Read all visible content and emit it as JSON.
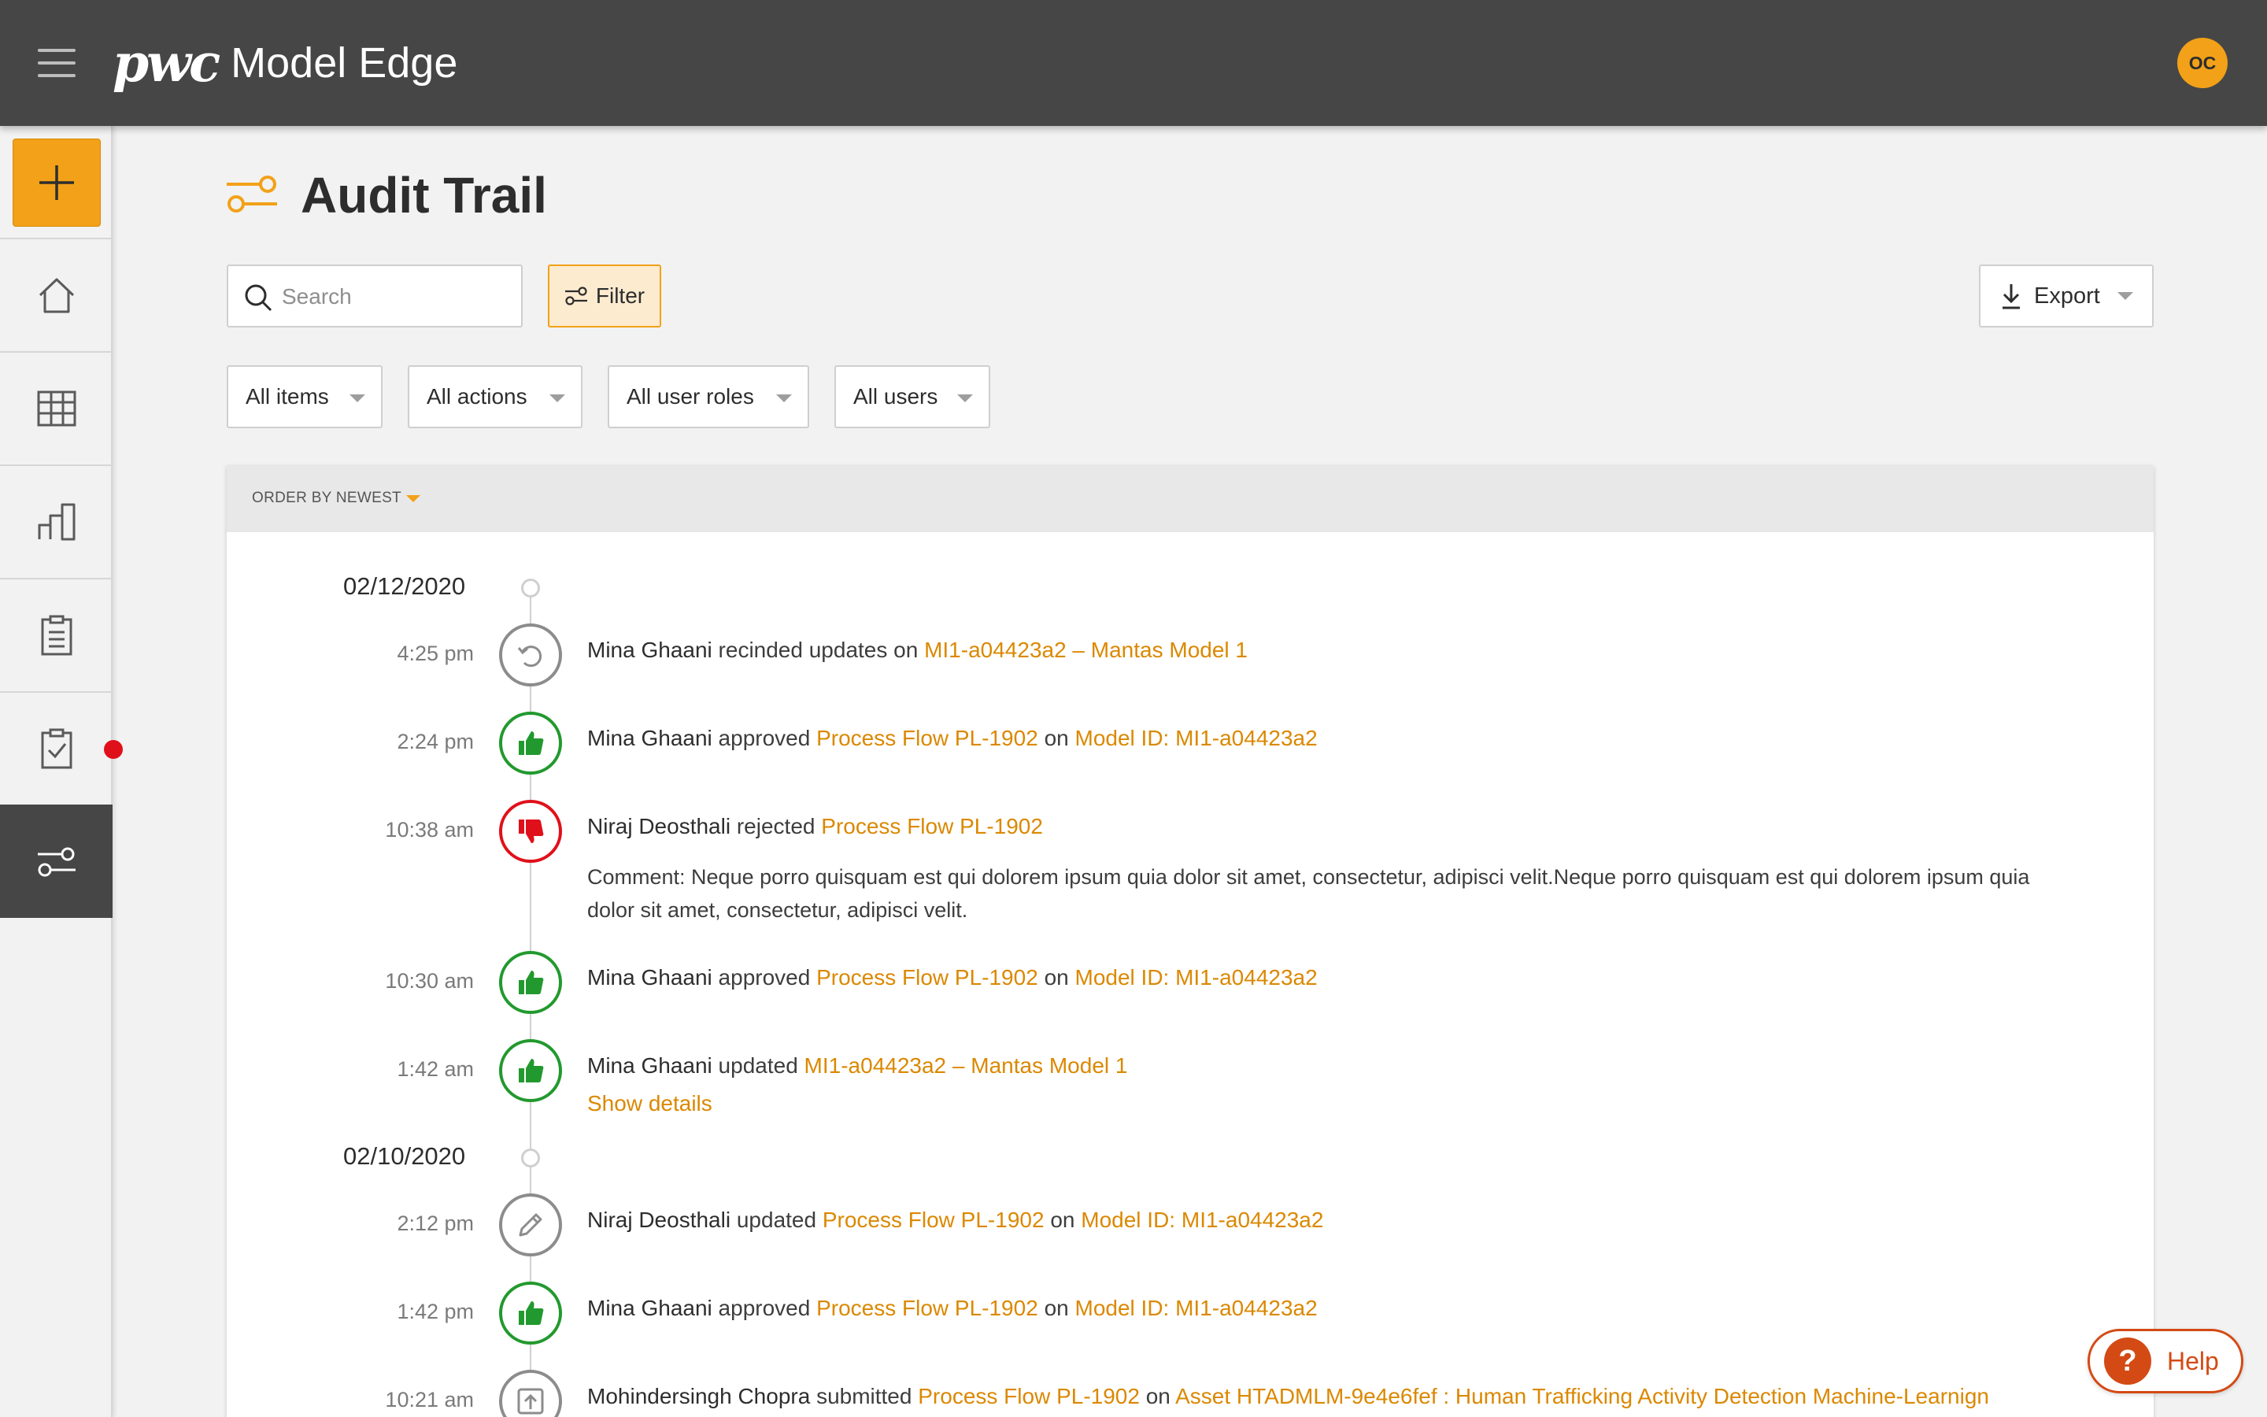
{
  "app": {
    "brand_mark": "pwc",
    "brand_name": "Model Edge",
    "user_initials": "OC"
  },
  "page": {
    "title": "Audit Trail"
  },
  "toolbar": {
    "search_placeholder": "Search",
    "filter_label": "Filter",
    "export_label": "Export"
  },
  "filters": {
    "items": "All items",
    "actions": "All actions",
    "user_roles": "All user roles",
    "users": "All users"
  },
  "list": {
    "order_label": "ORDER BY NEWEST",
    "groups": [
      {
        "date": "02/12/2020",
        "events": [
          {
            "time": "4:25 pm",
            "type": "rescind",
            "user": "Mina Ghaani",
            "action": "recinded updates on",
            "link1": "MI1-a04423a2 – Mantas Model 1"
          },
          {
            "time": "2:24 pm",
            "type": "approve",
            "user": "Mina Ghaani",
            "action": "approved",
            "link1": "Process Flow PL-1902",
            "conj": "on",
            "link2": "Model ID: MI1-a04423a2"
          },
          {
            "time": "10:38 am",
            "type": "reject",
            "user": "Niraj Deosthali",
            "action": "rejected",
            "link1": "Process Flow PL-1902",
            "comment": "Comment: Neque porro quisquam est qui dolorem ipsum quia dolor sit amet, consectetur, adipisci velit.Neque porro quisquam est qui dolorem ipsum quia dolor sit amet, consectetur, adipisci velit."
          },
          {
            "time": "10:30 am",
            "type": "approve",
            "user": "Mina Ghaani",
            "action": "approved",
            "link1": "Process Flow PL-1902",
            "conj": "on",
            "link2": "Model ID: MI1-a04423a2"
          },
          {
            "time": "1:42 am",
            "type": "approve",
            "user": "Mina Ghaani",
            "action": "updated",
            "link1": "MI1-a04423a2 – Mantas Model 1",
            "details_label": "Show details"
          }
        ]
      },
      {
        "date": "02/10/2020",
        "events": [
          {
            "time": "2:12 pm",
            "type": "edit",
            "user": "Niraj Deosthali",
            "action": "updated",
            "link1": "Process Flow PL-1902",
            "conj": "on",
            "link2": "Model ID: MI1-a04423a2"
          },
          {
            "time": "1:42 pm",
            "type": "approve",
            "user": "Mina Ghaani",
            "action": "approved",
            "link1": "Process Flow PL-1902",
            "conj": "on",
            "link2": "Model ID: MI1-a04423a2"
          },
          {
            "time": "10:21 am",
            "type": "submit",
            "user": "Mohindersingh Chopra",
            "action": "submitted",
            "link1": "Process Flow PL-1902",
            "conj": "on",
            "link2": "Asset HTADMLM-9e4e6fef : Human Trafficking Activity Detection Machine-Learnign"
          }
        ]
      }
    ]
  },
  "help": {
    "icon": "?",
    "label": "Help"
  },
  "colors": {
    "accent": "#f2a118",
    "link": "#db8800",
    "approve": "#22992e",
    "reject": "#e0101a",
    "topbar": "#464646",
    "help": "#d44a15"
  },
  "icons": {
    "menu": "hamburger-icon",
    "add": "plus-icon",
    "home": "home-icon",
    "table": "table-icon",
    "chart": "bar-chart-icon",
    "clipboard": "clipboard-icon",
    "tasks": "clipboard-check-icon",
    "audit": "audit-trail-icon",
    "search": "search-icon",
    "filter": "filter-icon",
    "export": "download-icon",
    "rescind": "undo-icon",
    "approve": "thumbs-up-icon",
    "reject": "thumbs-down-icon",
    "edit": "pencil-icon",
    "submit": "upload-icon"
  }
}
